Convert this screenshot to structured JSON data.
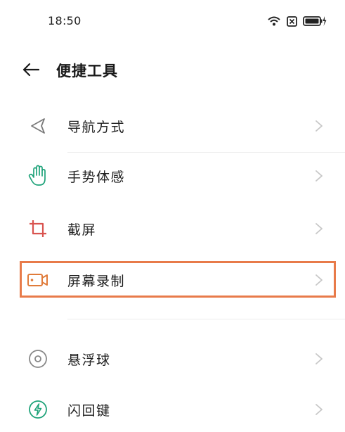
{
  "status_bar": {
    "time": "18:50",
    "icons": [
      "wifi-icon",
      "sim-icon",
      "battery-charging-icon"
    ]
  },
  "header": {
    "back_icon": "arrow-left-icon",
    "title": "便捷工具"
  },
  "items": [
    {
      "label": "导航方式",
      "icon": "navigation-triangle-icon"
    },
    {
      "label": "手势体感",
      "icon": "hand-gesture-icon"
    },
    {
      "label": "截屏",
      "icon": "crop-icon"
    },
    {
      "label": "屏幕录制",
      "icon": "video-camera-icon",
      "highlighted": true
    },
    {
      "label": "悬浮球",
      "icon": "floating-ball-icon"
    },
    {
      "label": "闪回键",
      "icon": "flash-back-icon"
    }
  ],
  "colors": {
    "highlight_border": "#e87b4a",
    "green_icon": "#1fa37a",
    "red_icon": "#d9534f",
    "orange_icon": "#e07b3a",
    "gray_icon": "#888888",
    "chevron": "#c7c7c7"
  }
}
